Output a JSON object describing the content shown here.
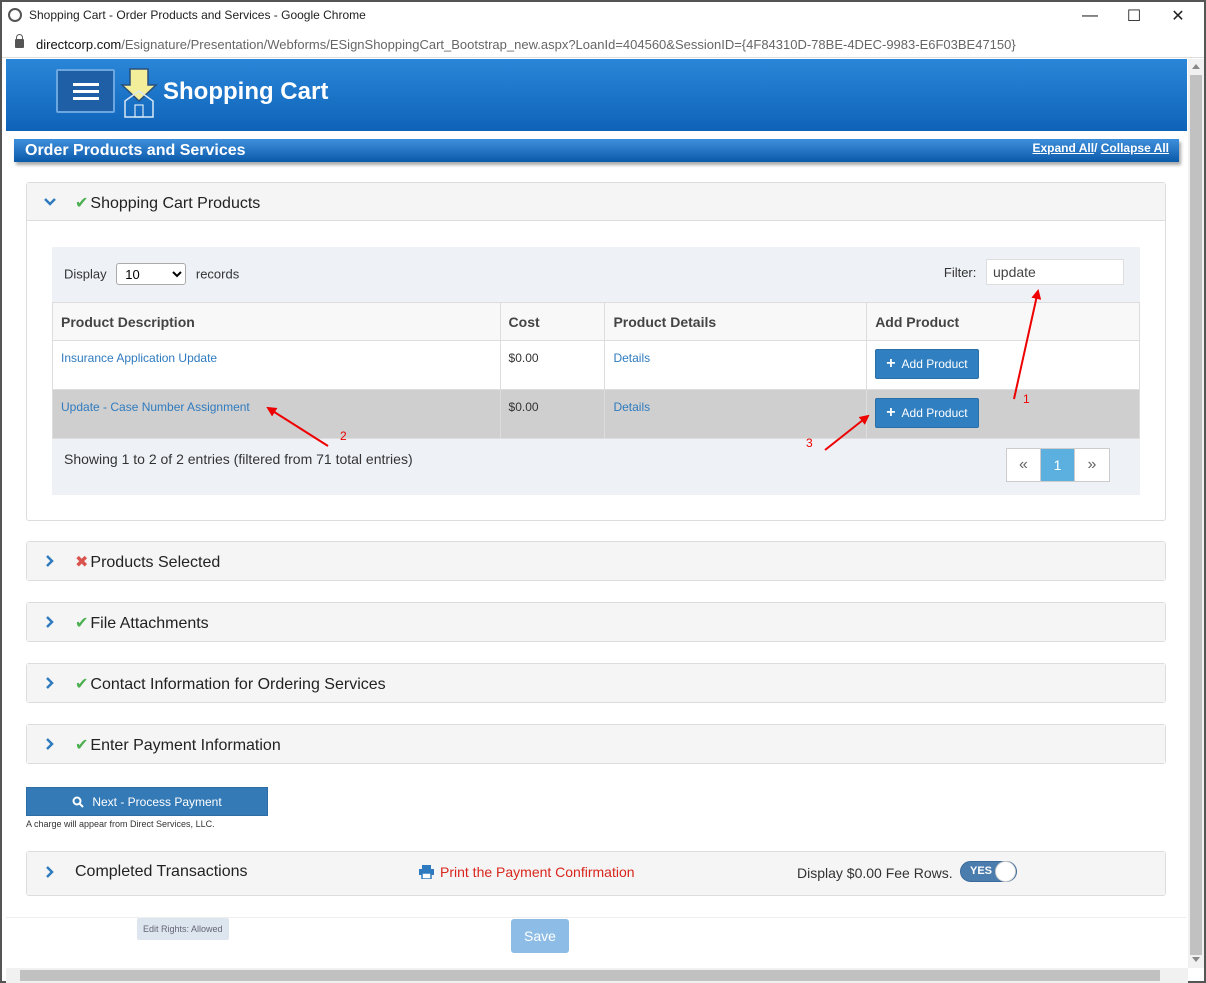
{
  "browser": {
    "window_title": "Shopping Cart - Order Products and Services - Google Chrome",
    "url_host": "directcorp.com",
    "url_path": "/Esignature/Presentation/Webforms/ESignShoppingCart_Bootstrap_new.aspx?LoanId=404560&SessionID={4F84310D-78BE-4DEC-9983-E6F03BE47150}"
  },
  "header": {
    "title": "Shopping Cart"
  },
  "section": {
    "title": "Order Products and Services",
    "expand_all": "Expand All",
    "separator": "/ ",
    "collapse_all": "Collapse All"
  },
  "cart_panel": {
    "title": "Shopping Cart Products",
    "display_label": "Display",
    "display_value": "10",
    "records_label": "records",
    "filter_label": "Filter:",
    "filter_value": "update",
    "columns": [
      "Product Description",
      "Cost",
      "Product Details",
      "Add Product"
    ],
    "rows": [
      {
        "description": "Insurance Application Update",
        "cost": "$0.00",
        "details": "Details",
        "add": "Add Product"
      },
      {
        "description": "Update - Case Number Assignment",
        "cost": "$0.00",
        "details": "Details",
        "add": "Add Product"
      }
    ],
    "showing": "Showing 1 to 2 of 2 entries (filtered from 71 total entries)",
    "pager": {
      "first": "«",
      "current": "1",
      "last": "»"
    }
  },
  "annotations": [
    "1",
    "2",
    "3"
  ],
  "panels": [
    {
      "title": "Products Selected",
      "status": "✖"
    },
    {
      "title": "File Attachments",
      "status": "✔"
    },
    {
      "title": "Contact Information for Ordering Services",
      "status": "✔"
    },
    {
      "title": "Enter Payment Information",
      "status": "✔"
    }
  ],
  "next_button": "Next - Process Payment",
  "charge_note": "A charge will appear from Direct Services, LLC.",
  "completed": {
    "title": "Completed Transactions",
    "print_link": "Print the Payment Confirmation",
    "fee_label": "Display $0.00 Fee Rows.",
    "toggle_label": "YES"
  },
  "footer": {
    "edit_rights": "Edit Rights: Allowed",
    "save": "Save"
  },
  "colors": {
    "header_blue": "#0e63b8",
    "button_blue": "#337ab7",
    "check_green": "#4caf50",
    "cross_red": "#d9534f",
    "annotation_red": "#e00000"
  }
}
